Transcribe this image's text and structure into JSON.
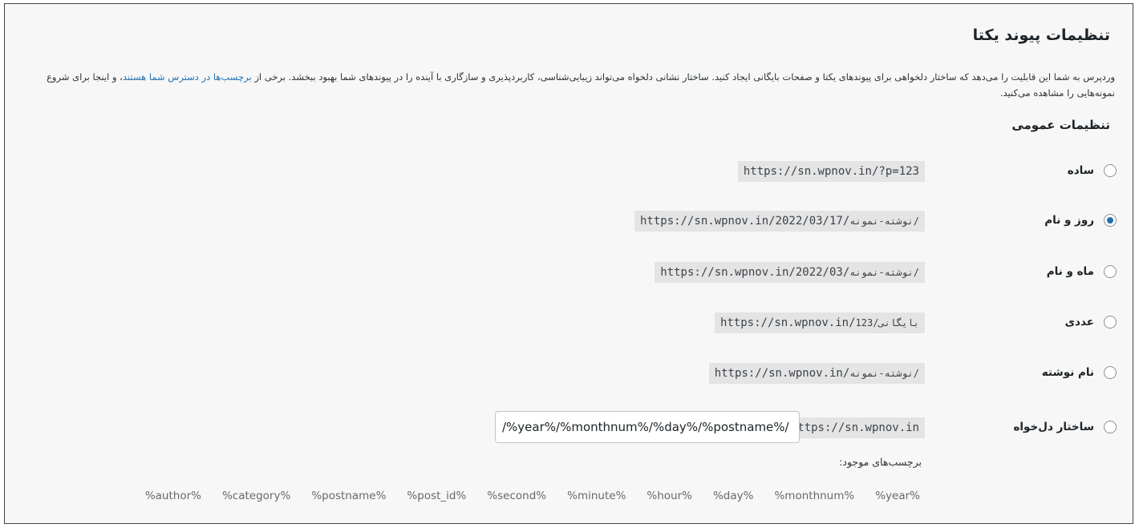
{
  "page": {
    "title": "تنظیمات پیوند یکتا",
    "description_part1": "وردپرس به شما این قابلیت را می‌دهد که ساختار دلخواهی برای پیوندهای یکتا و صفحات بایگانی ایجاد کنید. ساختار نشانی دلخواه می‌تواند زیبایی‌شناسی، کاربردپذیری و سازگاری با آینده را در پیوندهای شما بهبود ببخشد. برخی از ",
    "description_link": "برچسب‌ها در دسترس شما هستند",
    "description_part2": "، و اینجا برای شروع نمونه‌هایی را مشاهده می‌کنید.",
    "section_title": "تنظیمات عمومی"
  },
  "options": [
    {
      "label": "ساده",
      "url_main": "https://sn.wpnov.in/?p=123",
      "url_fa": "",
      "checked": false
    },
    {
      "label": "روز و نام",
      "url_main": "https://sn.wpnov.in/2022/03/17/",
      "url_fa": "نوشته-نمونه/",
      "checked": true
    },
    {
      "label": "ماه و نام",
      "url_main": "https://sn.wpnov.in/2022/03/",
      "url_fa": "نوشته-نمونه/",
      "checked": false
    },
    {
      "label": "عددی",
      "url_main": "https://sn.wpnov.in/",
      "url_fa": "بایگانی/123",
      "checked": false
    },
    {
      "label": "نام نوشته",
      "url_main": "https://sn.wpnov.in/",
      "url_fa": "نوشته-نمونه/",
      "checked": false
    },
    {
      "label": "ساختار دل‌خواه",
      "url_main": "https://sn.wpnov.in",
      "url_fa": "",
      "checked": false
    }
  ],
  "custom": {
    "value": "/%year%/%monthnum%/%day%/%postname%/",
    "available_tags_label": "برچسب‌های موجود:",
    "tags": [
      "%year%",
      "%monthnum%",
      "%day%",
      "%hour%",
      "%minute%",
      "%second%",
      "%post_id%",
      "%postname%",
      "%category%",
      "%author%"
    ]
  },
  "colors": {
    "link": "#2271b1",
    "radio_checked": "#2271b1"
  }
}
